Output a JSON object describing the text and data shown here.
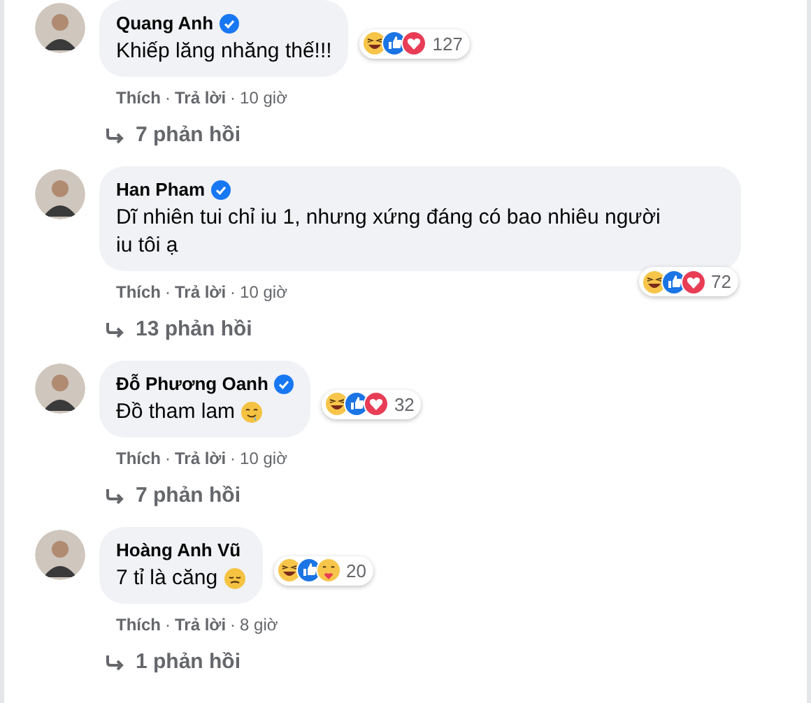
{
  "comments": [
    {
      "kind": "short",
      "author": "Quang Anh",
      "verified": true,
      "text": "Khiếp lăng nhăng thế!!!",
      "reactions": [
        {
          "kind": "haha"
        },
        {
          "kind": "like"
        },
        {
          "kind": "love"
        }
      ],
      "reaction_count": "127",
      "actions": [
        "Thích",
        "Trả lời"
      ],
      "separator": "·",
      "time": "10 giờ",
      "replies": "7 phản hồi"
    },
    {
      "kind": "long",
      "author": "Han Pham",
      "verified": true,
      "text": "Dĩ nhiên tui chỉ iu 1, nhưng xứng đáng có bao nhiêu người iu tôi ạ",
      "reactions": [
        {
          "kind": "haha"
        },
        {
          "kind": "like"
        },
        {
          "kind": "love"
        }
      ],
      "reaction_count": "72",
      "actions": [
        "Thích",
        "Trả lời"
      ],
      "separator": "·",
      "time": "10 giờ",
      "replies": "13 phản hồi"
    },
    {
      "kind": "short",
      "author": "Đỗ Phương Oanh",
      "verified": true,
      "text": "Đồ tham lam",
      "emoji": {
        "kind": "drool"
      },
      "reactions": [
        {
          "kind": "haha"
        },
        {
          "kind": "like"
        },
        {
          "kind": "love"
        }
      ],
      "reaction_count": "32",
      "actions": [
        "Thích",
        "Trả lời"
      ],
      "separator": "·",
      "time": "10 giờ",
      "replies": "7 phản hồi"
    },
    {
      "kind": "short",
      "author": "Hoàng Anh Vũ",
      "verified": false,
      "text": "7 tỉ là căng",
      "emoji": {
        "kind": "tired"
      },
      "reactions": [
        {
          "kind": "haha"
        },
        {
          "kind": "like"
        },
        {
          "kind": "care"
        }
      ],
      "reaction_count": "20",
      "actions": [
        "Thích",
        "Trả lời"
      ],
      "separator": "·",
      "time": "8 giờ",
      "replies": "1 phản hồi"
    }
  ]
}
